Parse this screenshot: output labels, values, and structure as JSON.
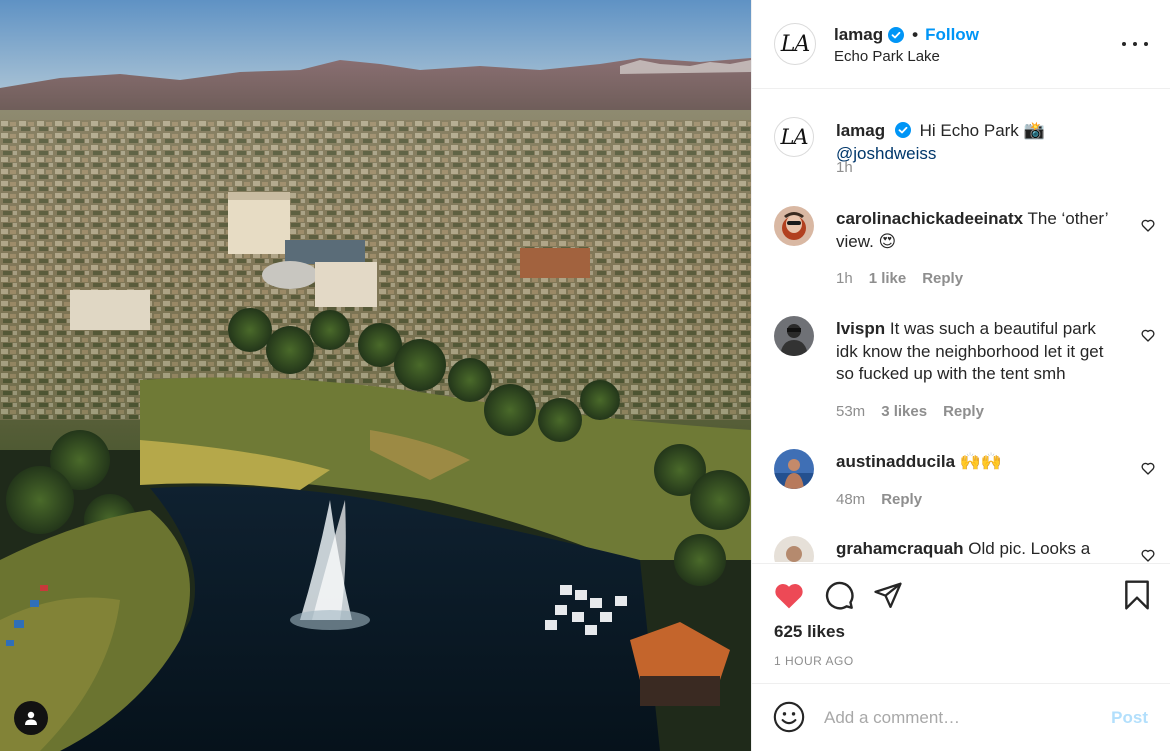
{
  "post": {
    "username": "lamag",
    "avatar_text": "LA",
    "follow_label": "Follow",
    "separator": "•",
    "location": "Echo Park Lake"
  },
  "caption": {
    "username": "lamag",
    "text": "Hi Echo Park 📸",
    "mention": "@joshdweiss",
    "time": "1h"
  },
  "comments": [
    {
      "username": "carolinachickadeeinatx",
      "text": "The ‘other’ view. 😍",
      "time": "1h",
      "likes": "1 like",
      "reply": "Reply"
    },
    {
      "username": "lvispn",
      "text": "It was such a beautiful park idk know the neighborhood let it get so fucked up with the tent smh",
      "time": "53m",
      "likes": "3 likes",
      "reply": "Reply"
    },
    {
      "username": "austinadducila",
      "text": "🙌🙌",
      "time": "48m",
      "reply": "Reply"
    },
    {
      "username": "grahamcraquah",
      "text": "Old pic. Looks a"
    }
  ],
  "actions": {
    "likes": "625 likes",
    "time_ago": "1 HOUR AGO"
  },
  "composer": {
    "placeholder": "Add a comment…",
    "post_label": "Post"
  },
  "colors": {
    "link_blue": "#0095f6",
    "mention_blue": "#00376b",
    "like_red": "#ed4956",
    "muted_text": "#8e8e8e",
    "post_disabled": "#b2dffc"
  },
  "icons": [
    "user-tag-icon",
    "verified-badge-icon",
    "more-options-icon",
    "heart-icon",
    "comment-icon",
    "share-icon",
    "bookmark-icon",
    "emoji-icon"
  ]
}
